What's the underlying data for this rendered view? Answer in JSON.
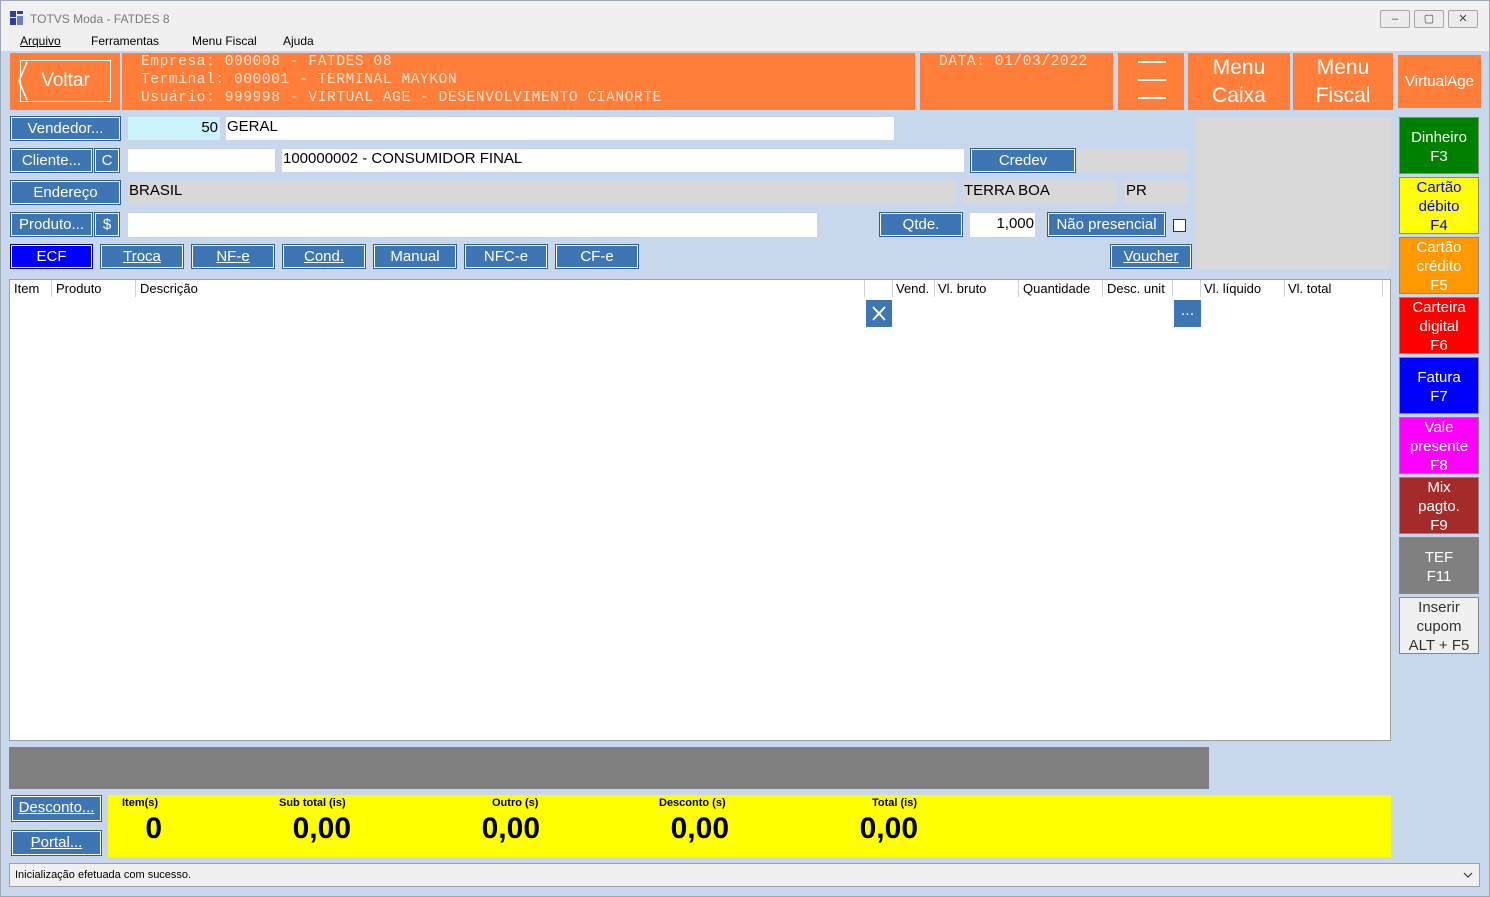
{
  "window": {
    "title": "TOTVS Moda - FATDES 8",
    "min": "–",
    "max": "▢",
    "close": "✕"
  },
  "menu": {
    "arquivo": "Arquivo",
    "ferramentas": "Ferramentas",
    "menu_fiscal": "Menu Fiscal",
    "ajuda": "Ajuda"
  },
  "header": {
    "voltar": "Voltar",
    "empresa": "Empresa: 000008 - FATDES 08",
    "terminal": "Terminal: 000001 - TERMINAL MAYKON",
    "usuario": "Usuário: 999998 - VIRTUAL AGE - DESENVOLVIMENTO CIANORTE",
    "data": "DATA: 01/03/2022",
    "menu_caixa_1": "Menu",
    "menu_caixa_2": "Caixa",
    "menu_fiscal_1": "Menu",
    "menu_fiscal_2": "Fiscal",
    "virtualage": "VirtualAge"
  },
  "form": {
    "vendedor_btn": "Vendedor...",
    "vendedor_code": "50",
    "vendedor_name": "GERAL",
    "cliente_btn": "Cliente...",
    "cliente_c": "C",
    "cliente_code": "",
    "cliente_name": "100000002 - CONSUMIDOR FINAL",
    "credev": "Credev",
    "endereco_btn": "Endereço",
    "endereco": "BRASIL",
    "cidade": "TERRA BOA",
    "uf": "PR",
    "produto_btn": "Produto...",
    "produto_dollar": "$",
    "produto_value": "",
    "qtde_btn": "Qtde.",
    "qtde_value": "1,000",
    "nao_presencial": "Não presencial"
  },
  "doc_buttons": {
    "ecf": "ECF",
    "troca": "Troca",
    "nfe": "NF-e",
    "cond": "Cond.",
    "manual": "Manual",
    "nfce": "NFC-e",
    "cfe": "CF-e",
    "voucher": "Voucher"
  },
  "grid": {
    "columns": [
      "Item",
      "Produto",
      "Descrição",
      "Vend.",
      "Vl. bruto",
      "Quantidade",
      "Desc. unit",
      "Vl. líquido",
      "Vl. total"
    ],
    "dots": "..."
  },
  "payments": [
    {
      "l1": "Dinheiro",
      "l2": "F3",
      "l3": "",
      "bg": "#008000",
      "fg": "#ffffff"
    },
    {
      "l1": "Cartão",
      "l2": "débito",
      "l3": "F4",
      "bg": "#ffff00",
      "fg": "#0000ff"
    },
    {
      "l1": "Cartão",
      "l2": "crédito",
      "l3": "F5",
      "bg": "#ff9900",
      "fg": "#ffffff"
    },
    {
      "l1": "Carteira",
      "l2": "digital",
      "l3": "F6",
      "bg": "#ff0000",
      "fg": "#ffffff"
    },
    {
      "l1": "Fatura",
      "l2": "F7",
      "l3": "",
      "bg": "#0000ff",
      "fg": "#ffffff"
    },
    {
      "l1": "Vale",
      "l2": "presente",
      "l3": "F8",
      "bg": "#ff00ff",
      "fg": "#ffffff"
    },
    {
      "l1": "Mix",
      "l2": "pagto.",
      "l3": "F9",
      "bg": "#a52a2a",
      "fg": "#ffffff"
    },
    {
      "l1": "TEF",
      "l2": "F11",
      "l3": "",
      "bg": "#808080",
      "fg": "#ffffff"
    },
    {
      "l1": "Inserir",
      "l2": "cupom",
      "l3": "ALT + F5",
      "bg": "#f0f0f0",
      "fg": "#333333"
    }
  ],
  "bottom": {
    "desconto_btn": "Desconto...",
    "portal_btn": "Portal...",
    "itens_label": "Item(s)",
    "itens_value": "0",
    "subtotal_label": "Sub total (is)",
    "subtotal_value": "0,00",
    "outro_label": "Outro (s)",
    "outro_value": "0,00",
    "desconto_label": "Desconto (s)",
    "desconto_value": "0,00",
    "total_label": "Total (is)",
    "total_value": "0,00"
  },
  "status": {
    "message": "Inicialização efetuada com sucesso."
  }
}
